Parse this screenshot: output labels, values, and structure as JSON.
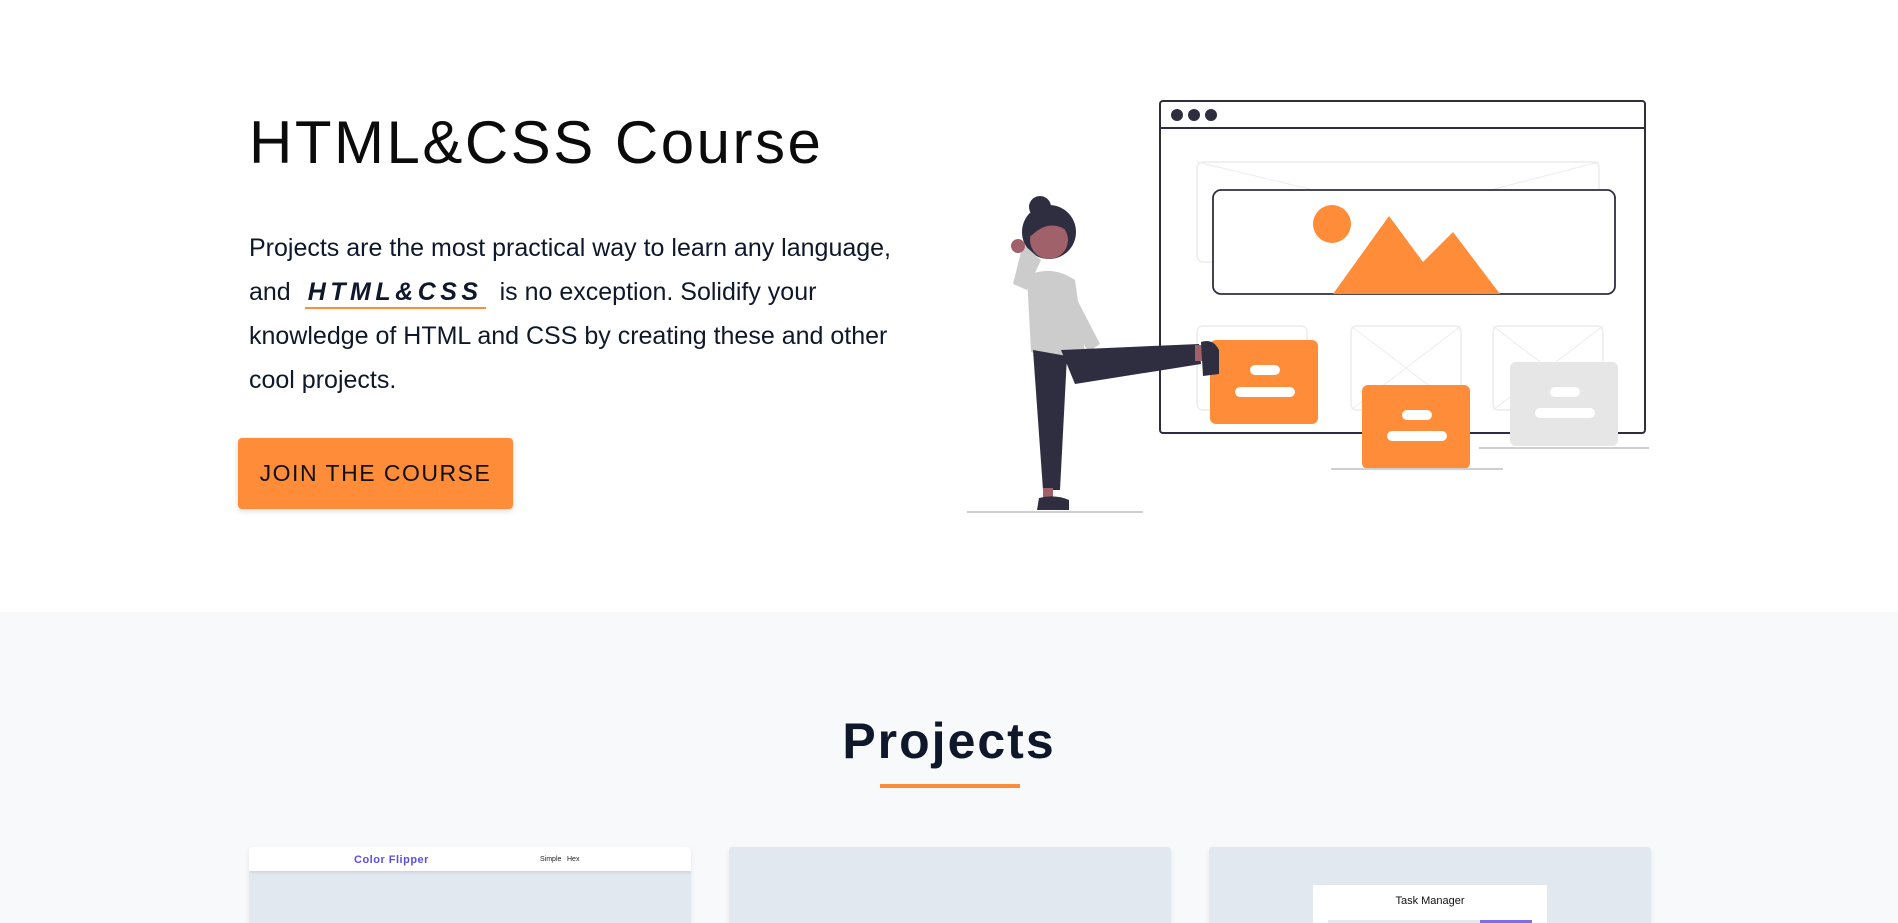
{
  "hero": {
    "title": "HTML&CSS Course",
    "text_before": "Projects are the most practical way to learn any language, and",
    "highlight": "HTML&CSS",
    "text_after": "is no exception. Solidify your knowledge of HTML and CSS by creating these and other cool projects.",
    "cta_label": "JOIN THE COURSE"
  },
  "projects": {
    "title": "Projects",
    "cards": [
      {
        "logo": "Color Flipper",
        "links": [
          "Simple",
          "Hex"
        ]
      },
      {},
      {
        "title": "Task Manager"
      }
    ]
  },
  "colors": {
    "accent": "#ff8c38",
    "dark": "#2f2e41",
    "text": "#0f172a",
    "section_bg": "#f8f9fb",
    "card_bg": "#e2e8f0",
    "purple": "#5b4ee6"
  },
  "icons": [
    "browser-window-illustration",
    "woman-kicking-illustration",
    "image-placeholder-icon"
  ]
}
